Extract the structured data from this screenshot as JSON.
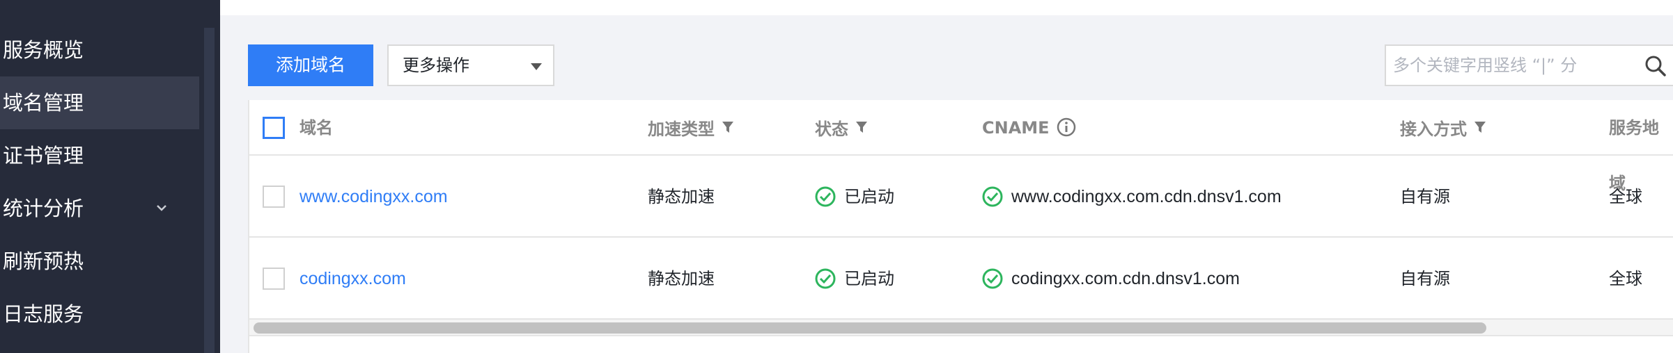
{
  "sidebar": {
    "items": [
      {
        "label": "服务概览"
      },
      {
        "label": "域名管理",
        "active": true
      },
      {
        "label": "证书管理"
      },
      {
        "label": "统计分析",
        "icon": "chevron-down-icon"
      },
      {
        "label": "刷新预热"
      },
      {
        "label": "日志服务"
      }
    ]
  },
  "toolbar": {
    "add_label": "添加域名",
    "more_label": "更多操作",
    "search_placeholder": "多个关键字用竖线 “|” 分"
  },
  "table": {
    "columns": [
      "域名",
      "加速类型",
      "状态",
      "CNAME",
      "接入方式",
      "服务地域"
    ],
    "rows": [
      {
        "domain": "www.codingxx.com",
        "type": "静态加速",
        "status": "已启动",
        "cname": "www.codingxx.com.cdn.dnsv1.com",
        "access": "自有源",
        "region": "全球"
      },
      {
        "domain": "codingxx.com",
        "type": "静态加速",
        "status": "已启动",
        "cname": "codingxx.com.cdn.dnsv1.com",
        "access": "自有源",
        "region": "全球"
      }
    ]
  },
  "colors": {
    "primary": "#2f7df6",
    "success": "#2db55d",
    "sidebar_bg": "#262b3a"
  }
}
